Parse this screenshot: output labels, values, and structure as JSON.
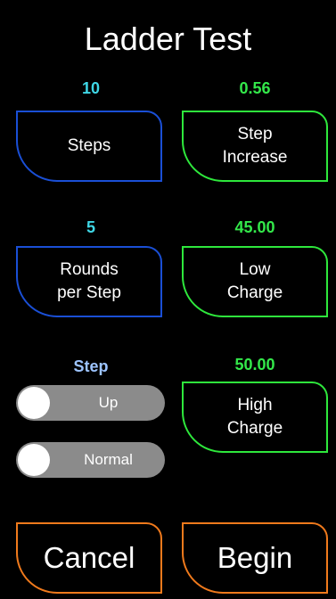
{
  "title": "Ladder Test",
  "colors": {
    "background": "#000000",
    "blue_border": "#1a4fd6",
    "green_border": "#2ee83c",
    "orange_border": "#f07a1c",
    "cyan_value": "#3fd7e6",
    "green_value": "#33e84a",
    "step_label": "#9dc4ff",
    "toggle_track": "#8b8b8b"
  },
  "steps": {
    "value": "10",
    "label": "Steps"
  },
  "step_increase": {
    "value": "0.56",
    "label": "Step\nIncrease"
  },
  "rounds": {
    "value": "5",
    "label": "Rounds\nper Step"
  },
  "low_charge": {
    "value": "45.00",
    "label": "Low\nCharge"
  },
  "high_charge": {
    "value": "50.00",
    "label": "High\nCharge"
  },
  "step_section": {
    "label": "Step",
    "direction_toggle": {
      "label": "Up",
      "state": "off"
    },
    "mode_toggle": {
      "label": "Normal",
      "state": "off"
    }
  },
  "actions": {
    "cancel_label": "Cancel",
    "begin_label": "Begin"
  }
}
